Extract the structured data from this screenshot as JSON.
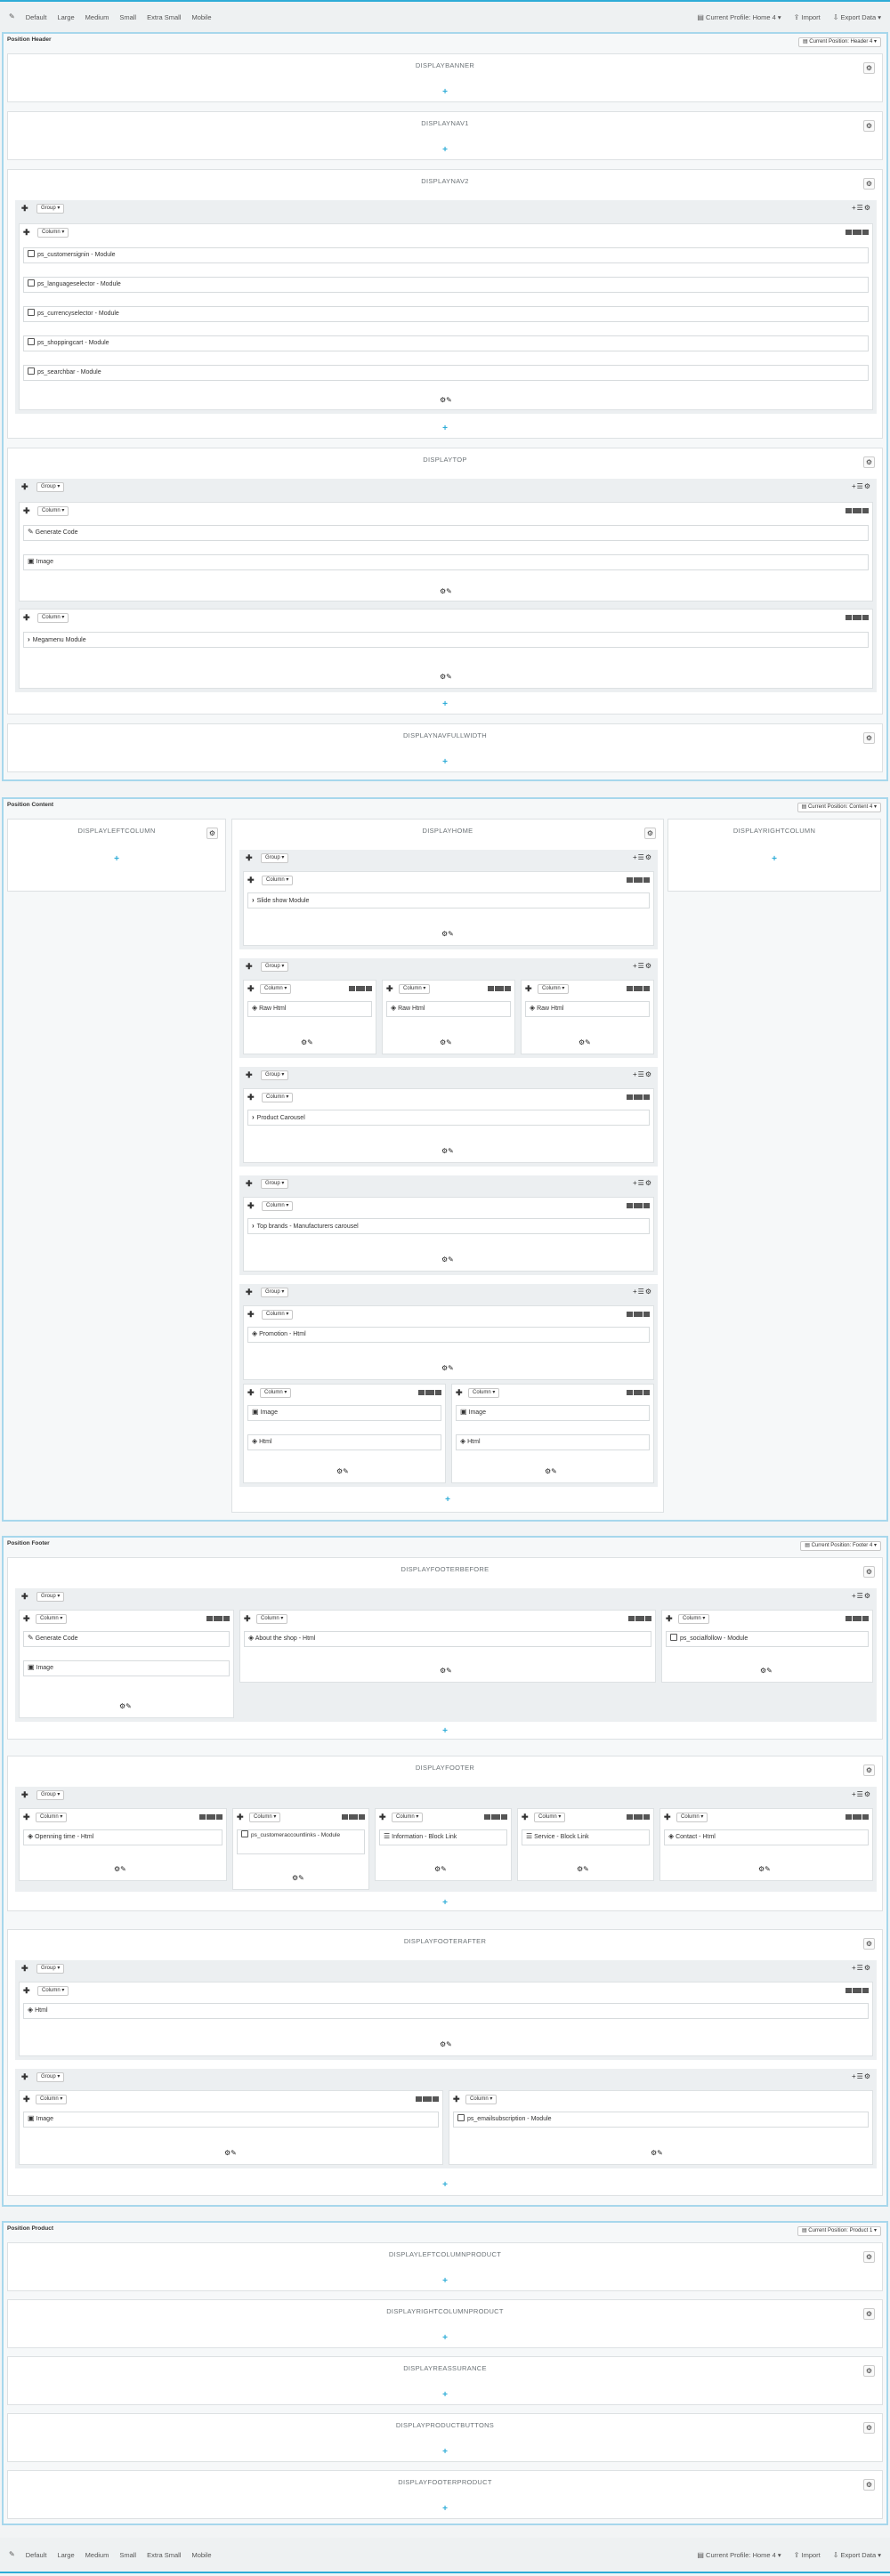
{
  "toolbar": {
    "sizes": [
      "Default",
      "Large",
      "Medium",
      "Small",
      "Extra Small",
      "Mobile"
    ],
    "profile": "Current Profile: Home 4 ▾",
    "import": "Import",
    "export": "Export Data ▾"
  },
  "positions": {
    "header": {
      "title": "Position Header",
      "button": "Current Position: Header 4 ▾"
    },
    "content": {
      "title": "Position Content",
      "button": "Current Position: Content 4 ▾"
    },
    "footer": {
      "title": "Position Footer",
      "button": "Current Position: Footer 4 ▾"
    },
    "product": {
      "title": "Position Product",
      "button": "Current Position: Product 1 ▾"
    }
  },
  "hooks": {
    "displaybanner": "DISPLAYBANNER",
    "displaynav1": "DISPLAYNAV1",
    "displaynav2": "DISPLAYNAV2",
    "displaytop": "DISPLAYTOP",
    "displaynavfullwidth": "DISPLAYNAVFULLWIDTH",
    "displayleftcolumn": "DISPLAYLEFTCOLUMN",
    "displayhome": "DISPLAYHOME",
    "displayrightcolumn": "DISPLAYRIGHTCOLUMN",
    "displayfooterbefore": "DISPLAYFOOTERBEFORE",
    "displayfooter": "DISPLAYFOOTER",
    "displayfooterafter": "DISPLAYFOOTERAFTER",
    "displayleftcolumnproduct": "DISPLAYLEFTCOLUMNPRODUCT",
    "displayrightcolumnproduct": "DISPLAYRIGHTCOLUMNPRODUCT",
    "displayreassurance": "DISPLAYREASSURANCE",
    "displayproductbuttons": "DISPLAYPRODUCTBUTTONS",
    "displayfooterproduct": "DISPLAYFOOTERPRODUCT"
  },
  "labels": {
    "group": "Group ▾",
    "column": "Column ▾"
  },
  "modules": {
    "customersignin": "ps_customersignin - Module",
    "languageselector": "ps_languageselector - Module",
    "currencyselector": "ps_currencyselector - Module",
    "shoppingcart": "ps_shoppingcart - Module",
    "searchbar": "ps_searchbar - Module",
    "generate_code": "Generate Code",
    "image": "Image",
    "megamenu": "Megamenu Module",
    "slideshow": "Slide show Module",
    "raw_html": "Raw Html",
    "product_carousel": "Product Carousel",
    "top_brands": "Top brands - Manufacturers carousel",
    "promotion": "Promotion - Html",
    "html": "Html",
    "about_shop": "About the shop - Html",
    "socialfollow": "ps_socialfollow - Module",
    "opening_time": "Openning time - Html",
    "customeraccountlinks": "ps_customeraccountlinks - Module",
    "information": "Information - Block Link",
    "service": "Service - Block Link",
    "contact": "Contact - Html",
    "emailsubscription": "ps_emailsubscription - Module"
  },
  "icons": {
    "gear": "⚙",
    "plus": "+",
    "move": "✚",
    "pencil": "✎",
    "chevron": "›"
  },
  "colors": {
    "accent": "#2eacd7",
    "border": "#a7d7ec"
  }
}
